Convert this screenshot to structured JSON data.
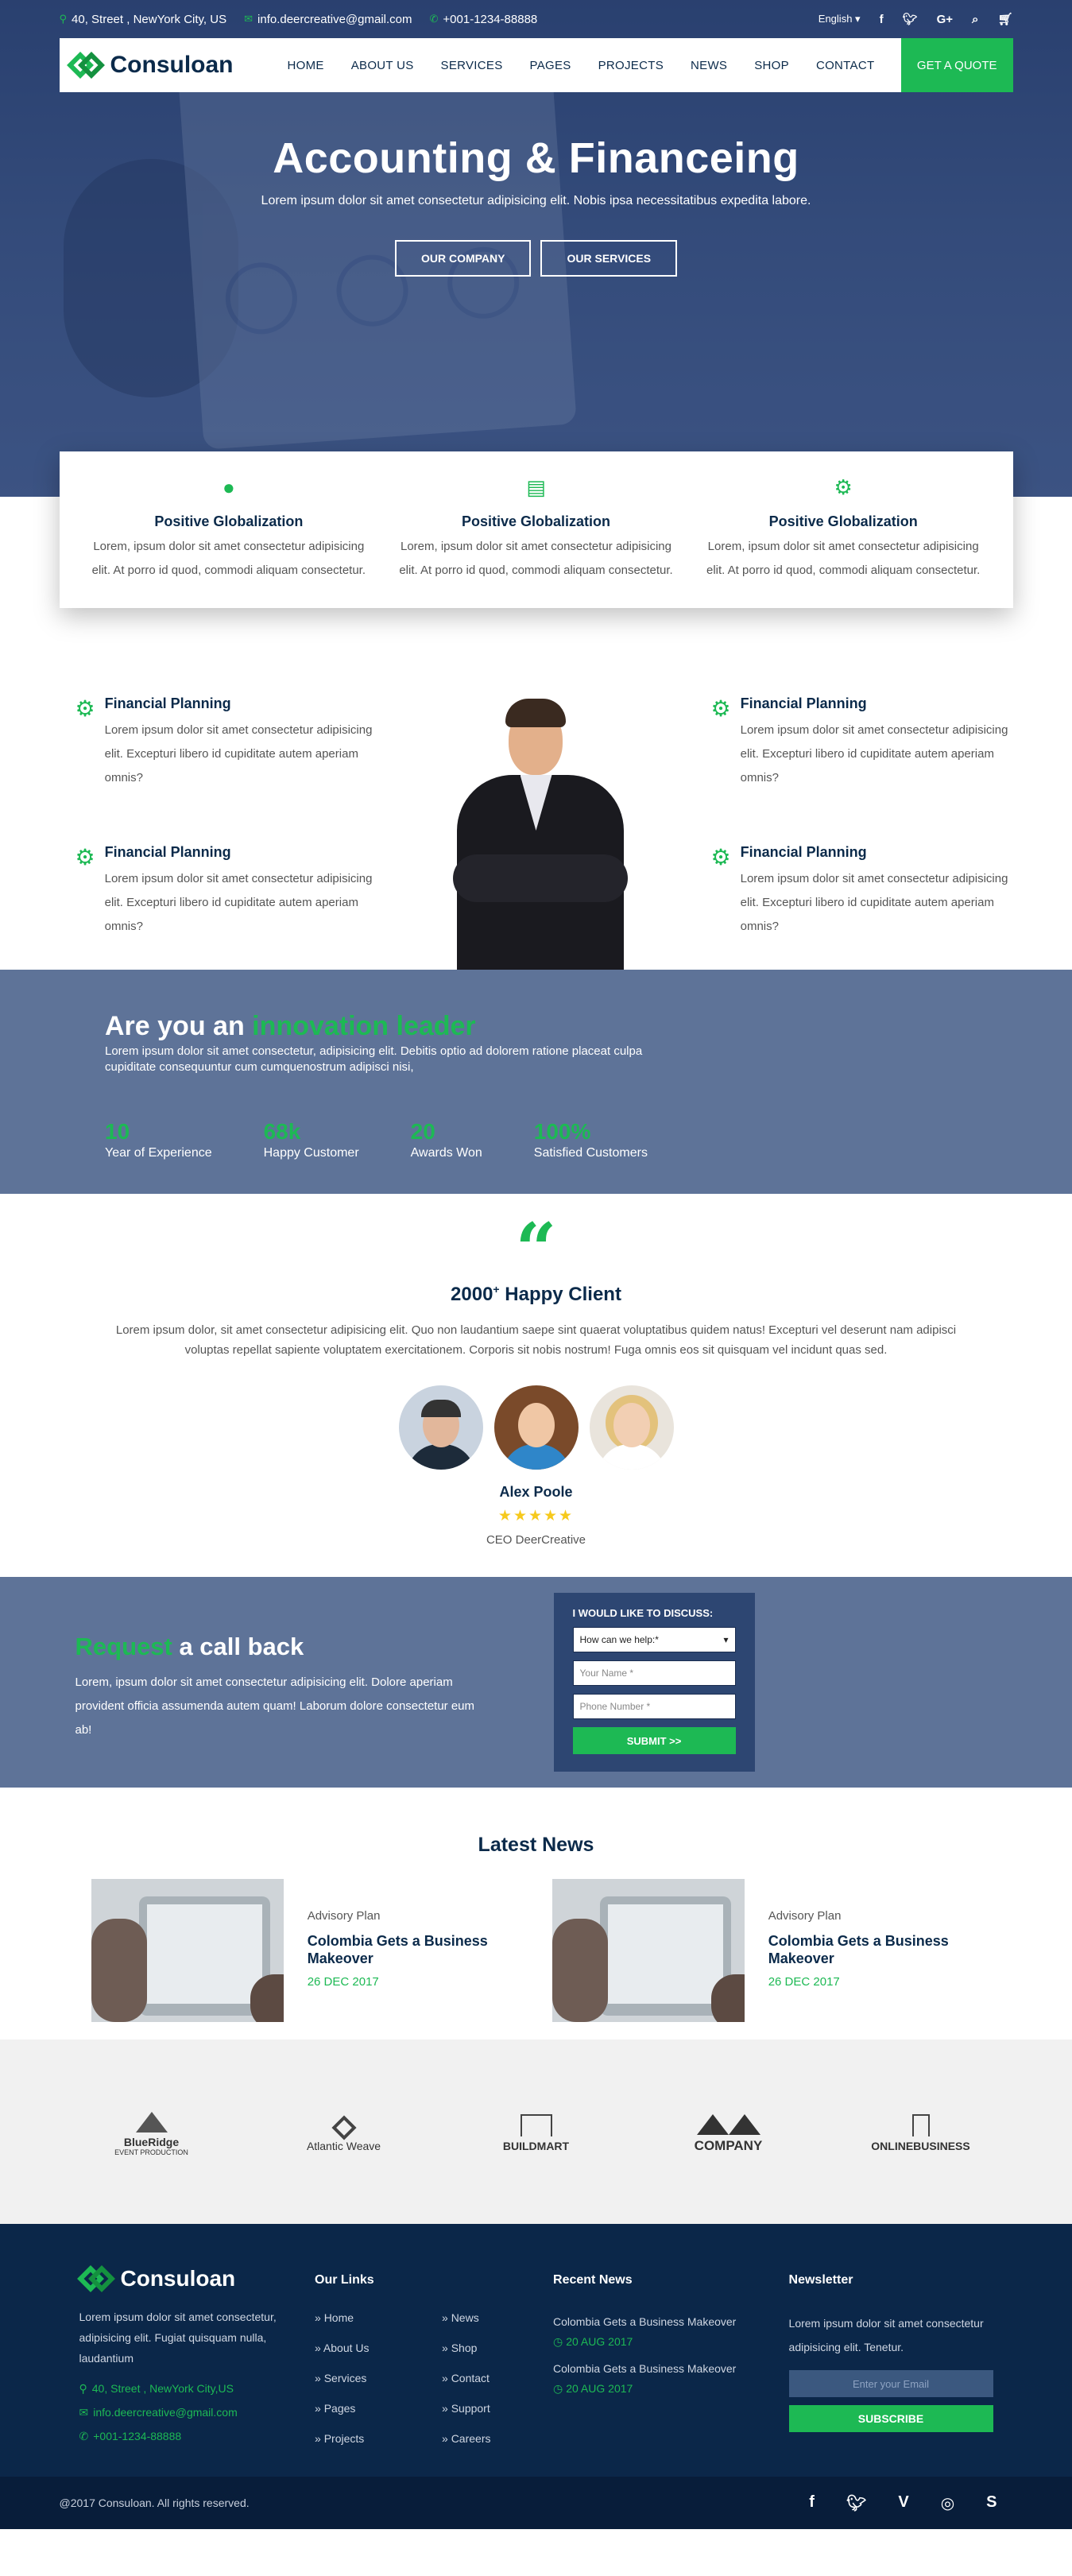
{
  "topbar": {
    "address": "40, Street , NewYork City, US",
    "email": "info.deercreative@gmail.com",
    "phone": "+001-1234-88888",
    "language": "English",
    "icons": [
      "facebook-icon",
      "twitter-icon",
      "google-plus-icon",
      "search-icon",
      "cart-icon"
    ]
  },
  "brand": {
    "name": "Consuloan",
    "accent": "#1db954",
    "navy": "#0b2a4a"
  },
  "nav": {
    "items": [
      "HOME",
      "ABOUT US",
      "SERVICES",
      "PAGES",
      "PROJECTS",
      "NEWS",
      "SHOP",
      "CONTACT"
    ],
    "cta": "GET A QUOTE"
  },
  "hero": {
    "title": "Accounting & Financeing",
    "subtitle": "Lorem ipsum dolor sit amet consectetur adipisicing elit. Nobis ipsa necessitatibus expedita labore.",
    "btn1": "OUR COMPANY",
    "btn2": "OUR SERVICES"
  },
  "features": [
    {
      "icon": "globe-icon",
      "title": "Positive Globalization",
      "text": "Lorem, ipsum dolor sit amet consectetur adipisicing elit. At porro id quod, commodi aliquam consectetur."
    },
    {
      "icon": "document-icon",
      "title": "Positive Globalization",
      "text": "Lorem, ipsum dolor sit amet consectetur adipisicing elit. At porro id quod, commodi aliquam consectetur."
    },
    {
      "icon": "gears-icon",
      "title": "Positive Globalization",
      "text": "Lorem, ipsum dolor sit amet consectetur adipisicing elit. At porro id quod, commodi aliquam consectetur."
    }
  ],
  "financial": [
    {
      "title": "Financial Planning",
      "text": "Lorem ipsum dolor sit amet consectetur adipisicing elit. Excepturi libero id cupiditate autem aperiam omnis?"
    },
    {
      "title": "Financial Planning",
      "text": "Lorem ipsum dolor sit amet consectetur adipisicing elit. Excepturi libero id cupiditate autem aperiam omnis?"
    },
    {
      "title": "Financial Planning",
      "text": "Lorem ipsum dolor sit amet consectetur adipisicing elit. Excepturi libero id cupiditate autem aperiam omnis?"
    },
    {
      "title": "Financial Planning",
      "text": "Lorem ipsum dolor sit amet consectetur adipisicing elit. Excepturi libero id cupiditate autem aperiam omnis?"
    }
  ],
  "innovation": {
    "title_prefix": "Are you an",
    "title_highlight": "innovation leader",
    "text": "Lorem ipsum dolor sit amet consectetur, adipisicing elit. Debitis optio ad dolorem ratione placeat culpa cupiditate consequuntur cum cumquenostrum adipisci nisi,",
    "stats": [
      {
        "num": "10",
        "label": "Year of Experience"
      },
      {
        "num": "68k",
        "label": "Happy Customer"
      },
      {
        "num": "20",
        "label": "Awards Won"
      },
      {
        "num": "100%",
        "label": "Satisfied Customers"
      }
    ]
  },
  "testimonial": {
    "quote_mark": "“",
    "title": "2000",
    "title_sup": "+",
    "title_suffix": " Happy Client",
    "text": "Lorem ipsum dolor, sit amet consectetur adipisicing elit. Quo non laudantium saepe sint quaerat voluptatibus quidem natus! Excepturi vel deserunt nam adipisci voluptas repellat sapiente voluptatem exercitationem. Corporis sit nobis nostrum! Fuga omnis eos sit quisquam vel incidunt quas sed.",
    "name": "Alex Poole",
    "stars": "★★★★★",
    "rating": 5,
    "role": "CEO DeerCreative"
  },
  "callback": {
    "title_highlight": "Request",
    "title_rest": "a call back",
    "text": "Lorem, ipsum dolor sit amet consectetur adipisicing elit. Dolore aperiam provident officia assumenda autem quam! Laborum dolore consectetur eum ab!",
    "form_title": "I WOULD LIKE TO DISCUSS:",
    "select_value": "How can we help:*",
    "name_placeholder": "Your Name *",
    "phone_placeholder": "Phone Number *",
    "submit": "SUBMIT >>"
  },
  "news": {
    "heading": "Latest News",
    "items": [
      {
        "category": "Advisory Plan",
        "title": "Colombia Gets a Business Makeover",
        "date": "26 DEC 2017"
      },
      {
        "category": "Advisory Plan",
        "title": "Colombia Gets a Business Makeover",
        "date": "26 DEC 2017"
      }
    ]
  },
  "logos": [
    {
      "name": "BlueRidge",
      "sub": "EVENT PRODUCTION"
    },
    {
      "name": "Atlantic Weave",
      "sub": ""
    },
    {
      "name": "BUILDMART",
      "sub": ""
    },
    {
      "name": "COMPANY",
      "sub": ""
    },
    {
      "name": "ONLINEBUSINESS",
      "sub": ""
    }
  ],
  "footer": {
    "about": "Lorem ipsum dolor sit amet consectetur, adipisicing elit. Fugiat quisquam nulla, laudantium",
    "address": "40, Street , NewYork City,US",
    "email": "info.deercreative@gmail.com",
    "phone": "+001-1234-88888",
    "links_title": "Our Links",
    "links": [
      "» Home",
      "» News",
      "» About Us",
      "» Shop",
      "» Services",
      "» Contact",
      "» Pages",
      "» Support",
      "» Projects",
      "» Careers"
    ],
    "recent_title": "Recent News",
    "recent": [
      {
        "title": "Colombia Gets a Business Makeover",
        "date": "20 AUG 2017"
      },
      {
        "title": "Colombia Gets a Business Makeover",
        "date": "20 AUG 2017"
      }
    ],
    "newsletter_title": "Newsletter",
    "newsletter_text": "Lorem ipsum dolor sit amet consectetur adipisicing elit. Tenetur.",
    "email_placeholder": "Enter your Email",
    "subscribe": "SUBSCRIBE"
  },
  "copyright": {
    "text": "@2017 Consuloan. All rights reserved.",
    "icons": [
      "facebook-icon",
      "twitter-icon",
      "vimeo-icon",
      "instagram-icon",
      "skype-icon"
    ]
  }
}
